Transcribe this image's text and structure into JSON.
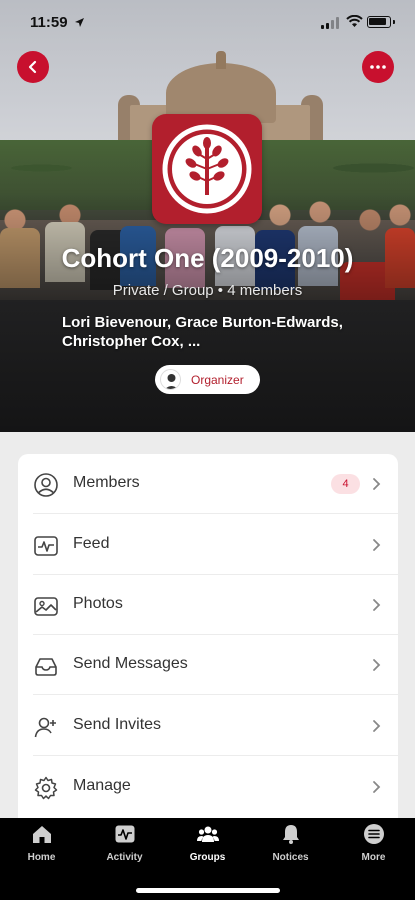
{
  "status_bar": {
    "time": "11:59"
  },
  "group": {
    "title": "Cohort One (2009-2010)",
    "meta": "Private / Group • 4 members",
    "member_names": "Lori Bievenour, Grace Burton-Edwards, Christopher Cox, ...",
    "organizer_label": "Organizer"
  },
  "menu": {
    "items": [
      {
        "label": "Members",
        "icon": "members-icon",
        "badge": "4"
      },
      {
        "label": "Feed",
        "icon": "feed-icon"
      },
      {
        "label": "Photos",
        "icon": "photos-icon"
      },
      {
        "label": "Send Messages",
        "icon": "inbox-icon"
      },
      {
        "label": "Send Invites",
        "icon": "add-user-icon"
      },
      {
        "label": "Manage",
        "icon": "gear-icon"
      }
    ]
  },
  "tabbar": {
    "items": [
      {
        "label": "Home",
        "icon": "home-icon"
      },
      {
        "label": "Activity",
        "icon": "activity-icon"
      },
      {
        "label": "Groups",
        "icon": "groups-icon",
        "active": true
      },
      {
        "label": "Notices",
        "icon": "bell-icon"
      },
      {
        "label": "More",
        "icon": "more-icon"
      }
    ]
  },
  "colors": {
    "accent": "#c8102e",
    "logo_bg": "#b21f2d",
    "badge_bg": "#fbe0e3",
    "tabbar_bg": "#000000"
  }
}
